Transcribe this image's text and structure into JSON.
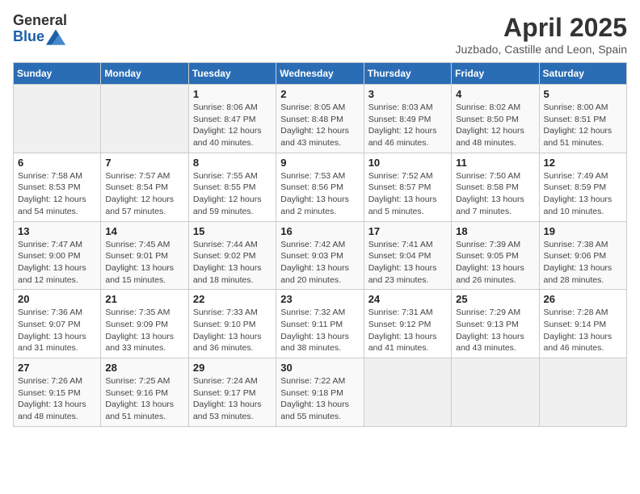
{
  "logo": {
    "general": "General",
    "blue": "Blue"
  },
  "title": "April 2025",
  "location": "Juzbado, Castille and Leon, Spain",
  "days_of_week": [
    "Sunday",
    "Monday",
    "Tuesday",
    "Wednesday",
    "Thursday",
    "Friday",
    "Saturday"
  ],
  "weeks": [
    [
      null,
      null,
      {
        "day": 1,
        "sunrise": "8:06 AM",
        "sunset": "8:47 PM",
        "daylight": "12 hours and 40 minutes."
      },
      {
        "day": 2,
        "sunrise": "8:05 AM",
        "sunset": "8:48 PM",
        "daylight": "12 hours and 43 minutes."
      },
      {
        "day": 3,
        "sunrise": "8:03 AM",
        "sunset": "8:49 PM",
        "daylight": "12 hours and 46 minutes."
      },
      {
        "day": 4,
        "sunrise": "8:02 AM",
        "sunset": "8:50 PM",
        "daylight": "12 hours and 48 minutes."
      },
      {
        "day": 5,
        "sunrise": "8:00 AM",
        "sunset": "8:51 PM",
        "daylight": "12 hours and 51 minutes."
      }
    ],
    [
      {
        "day": 6,
        "sunrise": "7:58 AM",
        "sunset": "8:53 PM",
        "daylight": "12 hours and 54 minutes."
      },
      {
        "day": 7,
        "sunrise": "7:57 AM",
        "sunset": "8:54 PM",
        "daylight": "12 hours and 57 minutes."
      },
      {
        "day": 8,
        "sunrise": "7:55 AM",
        "sunset": "8:55 PM",
        "daylight": "12 hours and 59 minutes."
      },
      {
        "day": 9,
        "sunrise": "7:53 AM",
        "sunset": "8:56 PM",
        "daylight": "13 hours and 2 minutes."
      },
      {
        "day": 10,
        "sunrise": "7:52 AM",
        "sunset": "8:57 PM",
        "daylight": "13 hours and 5 minutes."
      },
      {
        "day": 11,
        "sunrise": "7:50 AM",
        "sunset": "8:58 PM",
        "daylight": "13 hours and 7 minutes."
      },
      {
        "day": 12,
        "sunrise": "7:49 AM",
        "sunset": "8:59 PM",
        "daylight": "13 hours and 10 minutes."
      }
    ],
    [
      {
        "day": 13,
        "sunrise": "7:47 AM",
        "sunset": "9:00 PM",
        "daylight": "13 hours and 12 minutes."
      },
      {
        "day": 14,
        "sunrise": "7:45 AM",
        "sunset": "9:01 PM",
        "daylight": "13 hours and 15 minutes."
      },
      {
        "day": 15,
        "sunrise": "7:44 AM",
        "sunset": "9:02 PM",
        "daylight": "13 hours and 18 minutes."
      },
      {
        "day": 16,
        "sunrise": "7:42 AM",
        "sunset": "9:03 PM",
        "daylight": "13 hours and 20 minutes."
      },
      {
        "day": 17,
        "sunrise": "7:41 AM",
        "sunset": "9:04 PM",
        "daylight": "13 hours and 23 minutes."
      },
      {
        "day": 18,
        "sunrise": "7:39 AM",
        "sunset": "9:05 PM",
        "daylight": "13 hours and 26 minutes."
      },
      {
        "day": 19,
        "sunrise": "7:38 AM",
        "sunset": "9:06 PM",
        "daylight": "13 hours and 28 minutes."
      }
    ],
    [
      {
        "day": 20,
        "sunrise": "7:36 AM",
        "sunset": "9:07 PM",
        "daylight": "13 hours and 31 minutes."
      },
      {
        "day": 21,
        "sunrise": "7:35 AM",
        "sunset": "9:09 PM",
        "daylight": "13 hours and 33 minutes."
      },
      {
        "day": 22,
        "sunrise": "7:33 AM",
        "sunset": "9:10 PM",
        "daylight": "13 hours and 36 minutes."
      },
      {
        "day": 23,
        "sunrise": "7:32 AM",
        "sunset": "9:11 PM",
        "daylight": "13 hours and 38 minutes."
      },
      {
        "day": 24,
        "sunrise": "7:31 AM",
        "sunset": "9:12 PM",
        "daylight": "13 hours and 41 minutes."
      },
      {
        "day": 25,
        "sunrise": "7:29 AM",
        "sunset": "9:13 PM",
        "daylight": "13 hours and 43 minutes."
      },
      {
        "day": 26,
        "sunrise": "7:28 AM",
        "sunset": "9:14 PM",
        "daylight": "13 hours and 46 minutes."
      }
    ],
    [
      {
        "day": 27,
        "sunrise": "7:26 AM",
        "sunset": "9:15 PM",
        "daylight": "13 hours and 48 minutes."
      },
      {
        "day": 28,
        "sunrise": "7:25 AM",
        "sunset": "9:16 PM",
        "daylight": "13 hours and 51 minutes."
      },
      {
        "day": 29,
        "sunrise": "7:24 AM",
        "sunset": "9:17 PM",
        "daylight": "13 hours and 53 minutes."
      },
      {
        "day": 30,
        "sunrise": "7:22 AM",
        "sunset": "9:18 PM",
        "daylight": "13 hours and 55 minutes."
      },
      null,
      null,
      null
    ]
  ]
}
